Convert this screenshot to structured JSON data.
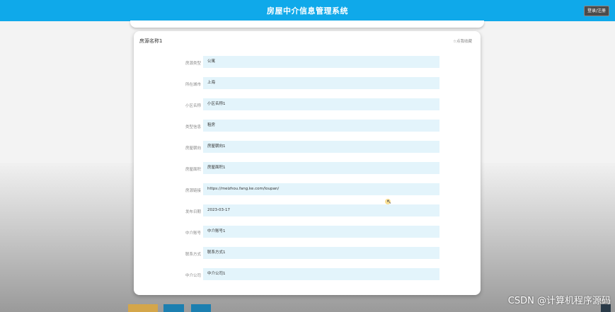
{
  "header": {
    "title": "房屋中介信息管理系统",
    "login_label": "登录/注册"
  },
  "detail": {
    "title": "房源名称1",
    "favorite_label": "☆点我收藏",
    "fields": [
      {
        "label": "房源类型",
        "value": "公寓"
      },
      {
        "label": "所在城市",
        "value": "上海"
      },
      {
        "label": "小区名称",
        "value": "小区名称1"
      },
      {
        "label": "类型信息",
        "value": "租房"
      },
      {
        "label": "房屋朝向",
        "value": "房屋朝向1"
      },
      {
        "label": "房屋面积",
        "value": "房屋面积1"
      },
      {
        "label": "房源链接",
        "value": "https://meizhou.fang.ke.com/loupan/"
      },
      {
        "label": "发布日期",
        "value": "2023-03-17"
      },
      {
        "label": "中介账号",
        "value": "中介账号1"
      },
      {
        "label": "联系方式",
        "value": "联系方式1"
      },
      {
        "label": "中介公司",
        "value": "中介公司1"
      }
    ]
  },
  "bottom_buttons": [
    {
      "color": "#d4a64a"
    },
    {
      "color": "#1c7fb0"
    },
    {
      "color": "#1c7fb0"
    }
  ],
  "watermark": "CSDN @计算机程序源码",
  "colors": {
    "header": "#0fa9ea",
    "field_bg": "#e3f4fb"
  }
}
